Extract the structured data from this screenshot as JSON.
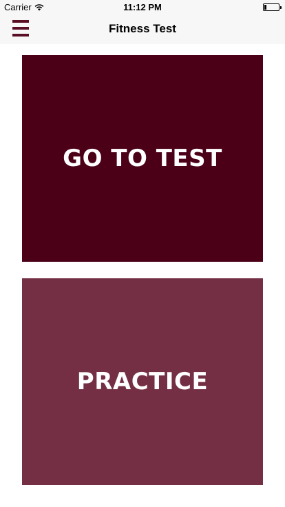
{
  "status_bar": {
    "carrier": "Carrier",
    "time": "11:12 PM",
    "wifi_icon": "wifi-icon",
    "battery_icon": "battery-icon"
  },
  "nav": {
    "title": "Fitness Test",
    "menu_icon": "hamburger-menu-icon"
  },
  "tiles": {
    "test": {
      "label": "GO TO TEST",
      "color": "#4b0018"
    },
    "practice": {
      "label": "PRACTICE",
      "color": "#742f44"
    }
  },
  "colors": {
    "accent": "#5a0f25",
    "nav_background": "#f7f7f7",
    "page_background": "#ffffff"
  }
}
